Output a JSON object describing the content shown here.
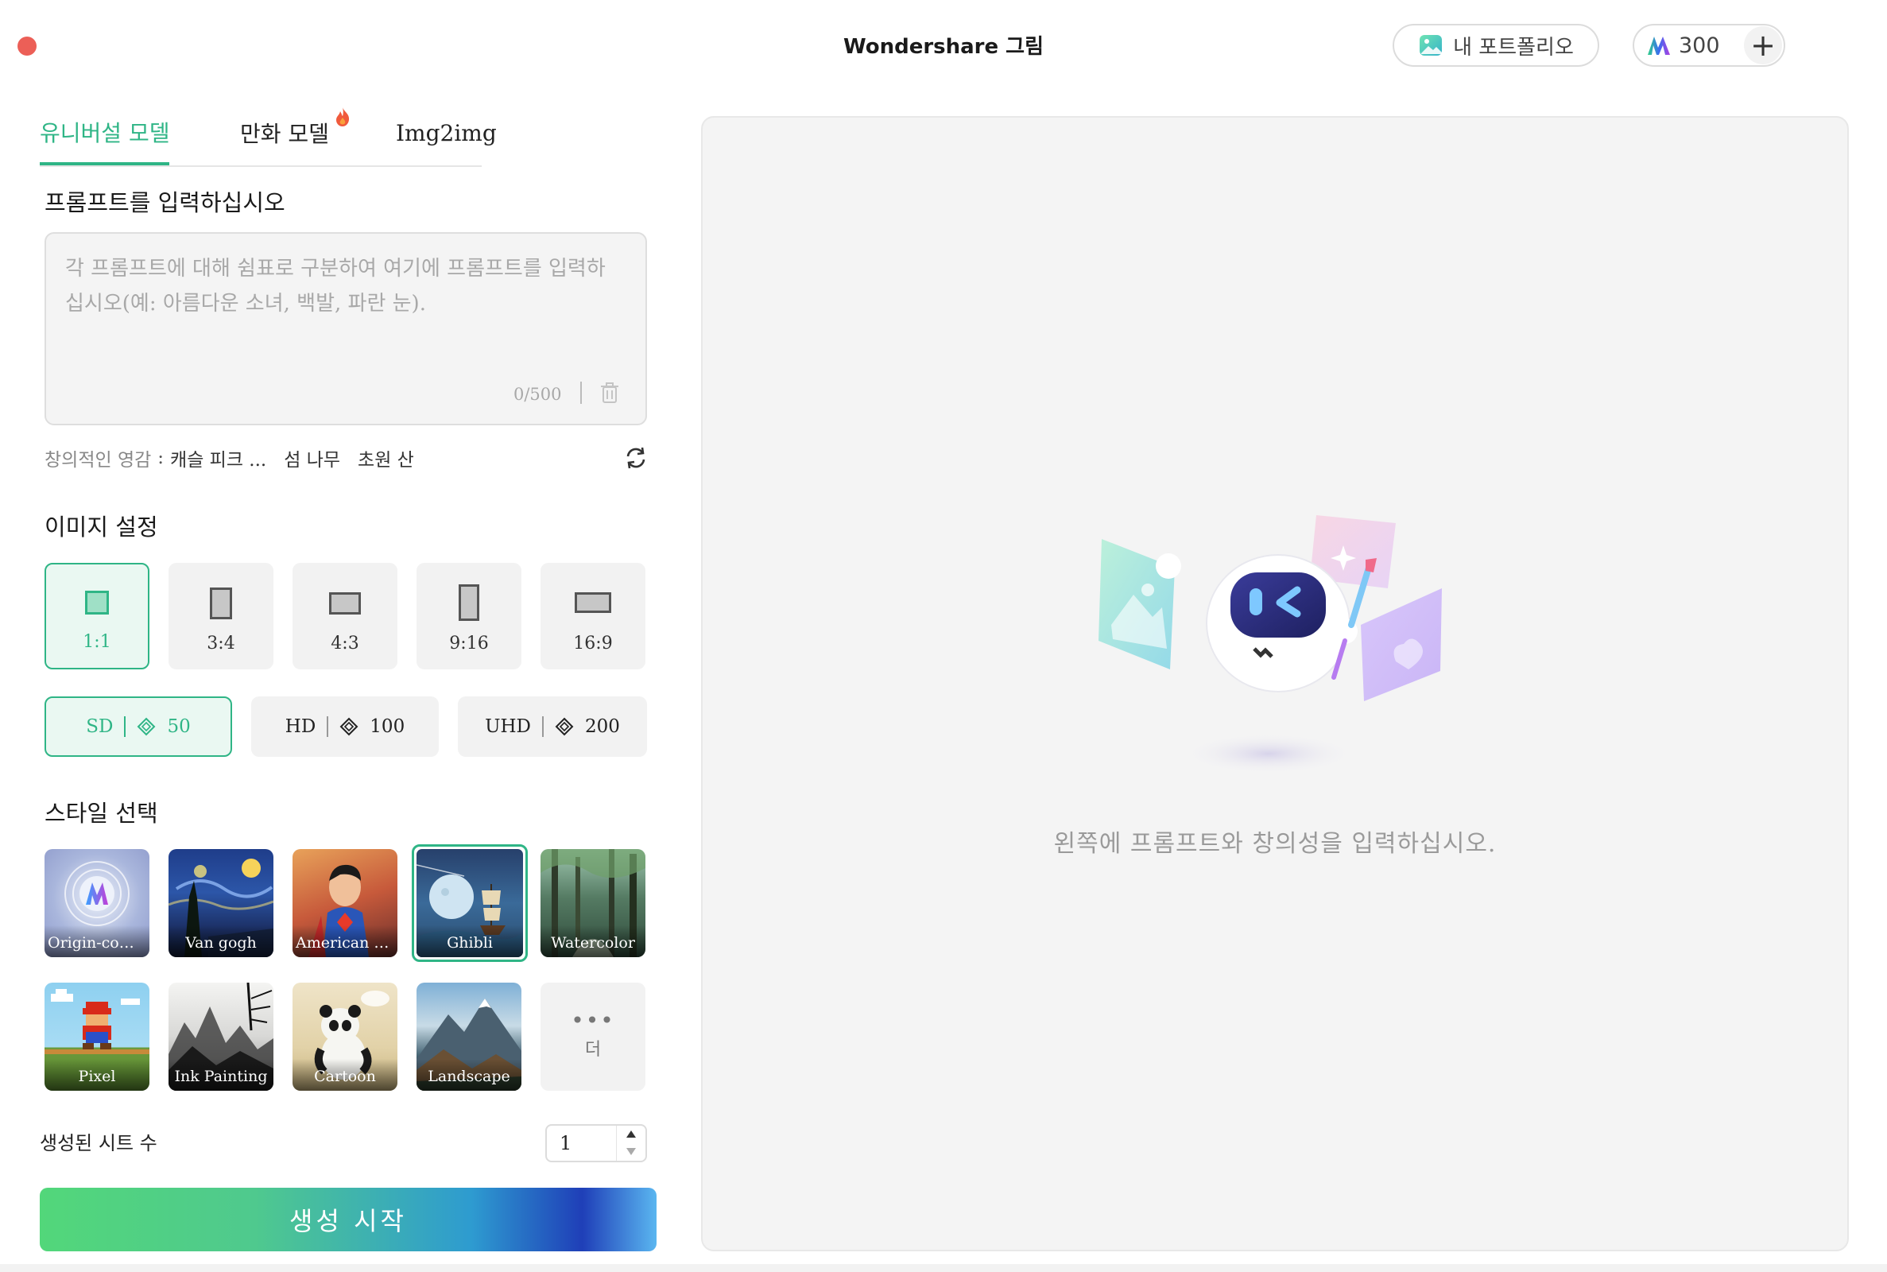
{
  "app": {
    "title": "Wondershare 그림",
    "portfolio_label": "내 포트폴리오",
    "credits": "300",
    "plus_label": "+"
  },
  "tabs": [
    {
      "label": "유니버설 모델",
      "active": true
    },
    {
      "label": "만화 모델",
      "badge": "hot-flame-icon"
    },
    {
      "label": "Img2img"
    }
  ],
  "prompt": {
    "title": "프롬프트를 입력하십시오",
    "placeholder": "각 프롬프트에 대해 쉼표로 구분하여 여기에 프롬프트를 입력하십시오(예: 아름다운 소녀, 백발, 파란 눈).",
    "counter": "0/500",
    "inspiration_label": "창의적인 영감",
    "inspiration_sep": ":",
    "inspirations": [
      "캐슬 피크 ...",
      "섬 나무",
      "초원 산"
    ]
  },
  "image_settings": {
    "title": "이미지 설정",
    "ratios": [
      {
        "label": "1:1",
        "selected": true
      },
      {
        "label": "3:4"
      },
      {
        "label": "4:3"
      },
      {
        "label": "9:16"
      },
      {
        "label": "16:9"
      }
    ],
    "qualities": [
      {
        "label": "SD",
        "cost": "50",
        "selected": true
      },
      {
        "label": "HD",
        "cost": "100"
      },
      {
        "label": "UHD",
        "cost": "200"
      }
    ]
  },
  "styles": {
    "title": "스타일 선택",
    "items": [
      {
        "label": "Origin-com..."
      },
      {
        "label": "Van gogh"
      },
      {
        "label": "American c..."
      },
      {
        "label": "Ghibli",
        "selected": true
      },
      {
        "label": "Watercolor"
      },
      {
        "label": "Pixel"
      },
      {
        "label": "Ink Painting"
      },
      {
        "label": "Cartoon"
      },
      {
        "label": "Landscape"
      }
    ],
    "more_dots": "•••",
    "more_label": "더"
  },
  "generation": {
    "count_label": "생성된 시트 수",
    "count_value": "1",
    "start_label": "생성 시작"
  },
  "preview": {
    "hint": "왼쪽에 프롬프트와 창의성을 입력하십시오."
  },
  "colors": {
    "accent": "#2fb586",
    "close_dot": "#ec5f57"
  }
}
